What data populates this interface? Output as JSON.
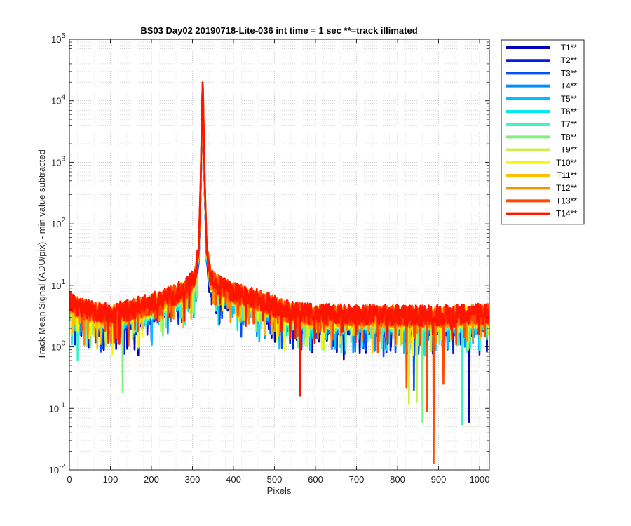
{
  "chart_data": {
    "type": "line",
    "title": "BS03 Day02 20190718-Lite-036 int time = 1 sec    **=track illimated",
    "xlabel": "Pixels",
    "ylabel": "Track Mean Signal (ADU/pix) - min value subtracted",
    "xlim": [
      0,
      1024
    ],
    "ylim": [
      0.01,
      100000
    ],
    "yscale": "log",
    "grid": true,
    "minor_grid": true,
    "legend_position": "outside-top-right",
    "x_ticks": [
      0,
      100,
      200,
      300,
      400,
      500,
      600,
      700,
      800,
      900,
      1000
    ],
    "x_tick_labels": [
      "0",
      "100",
      "200",
      "300",
      "400",
      "500",
      "600",
      "700",
      "800",
      "900",
      "1000"
    ],
    "y_ticks": [
      0.01,
      0.1,
      1,
      10,
      100,
      1000,
      10000,
      100000
    ],
    "y_tick_labels": [
      {
        "base": "10",
        "exp": "-2"
      },
      {
        "base": "10",
        "exp": "-1"
      },
      {
        "base": "10",
        "exp": "0"
      },
      {
        "base": "10",
        "exp": "1"
      },
      {
        "base": "10",
        "exp": "2"
      },
      {
        "base": "10",
        "exp": "3"
      },
      {
        "base": "10",
        "exp": "4"
      },
      {
        "base": "10",
        "exp": "5"
      }
    ],
    "peak": {
      "x": 325,
      "y": 20000
    },
    "x_profile": [
      0,
      30,
      100,
      200,
      280,
      305,
      315,
      320,
      325,
      330,
      335,
      345,
      370,
      400,
      460,
      530,
      600,
      700,
      800,
      900,
      1024
    ],
    "y_profile": [
      4.5,
      3.5,
      2.8,
      4.2,
      7.0,
      11,
      28,
      400,
      20000,
      400,
      30,
      11,
      8.0,
      6.5,
      5.0,
      3.2,
      2.8,
      2.8,
      2.7,
      2.7,
      2.9
    ],
    "dips": [
      {
        "series": "T14**",
        "x": 562,
        "y": 0.16
      },
      {
        "series": "T13**",
        "x": 888,
        "y": 0.013
      },
      {
        "series": "T13**",
        "x": 872,
        "y": 0.09
      },
      {
        "series": "T13**",
        "x": 822,
        "y": 0.22
      },
      {
        "series": "T9**",
        "x": 828,
        "y": 0.12
      },
      {
        "series": "T9**",
        "x": 847,
        "y": 0.13
      },
      {
        "series": "T8**",
        "x": 861,
        "y": 0.06
      },
      {
        "series": "T7**",
        "x": 957,
        "y": 0.055
      },
      {
        "series": "T1**",
        "x": 975,
        "y": 0.06
      },
      {
        "series": "T8**",
        "x": 130,
        "y": 0.18
      },
      {
        "series": "T7**",
        "x": 20,
        "y": 0.6
      },
      {
        "series": "T3**",
        "x": 840,
        "y": 0.2
      },
      {
        "series": "T13**",
        "x": 912,
        "y": 0.25
      }
    ],
    "series": [
      {
        "name": "T1**",
        "color": "#0000b4"
      },
      {
        "name": "T2**",
        "color": "#0020dc"
      },
      {
        "name": "T3**",
        "color": "#0050ff"
      },
      {
        "name": "T4**",
        "color": "#0090ff"
      },
      {
        "name": "T5**",
        "color": "#00c0ff"
      },
      {
        "name": "T6**",
        "color": "#00e8f0"
      },
      {
        "name": "T7**",
        "color": "#40f0c8"
      },
      {
        "name": "T8**",
        "color": "#80f080"
      },
      {
        "name": "T9**",
        "color": "#c8f040"
      },
      {
        "name": "T10**",
        "color": "#f8f800"
      },
      {
        "name": "T11**",
        "color": "#ffc000"
      },
      {
        "name": "T12**",
        "color": "#ff8c00"
      },
      {
        "name": "T13**",
        "color": "#ff4800"
      },
      {
        "name": "T14**",
        "color": "#ff1400"
      }
    ]
  }
}
